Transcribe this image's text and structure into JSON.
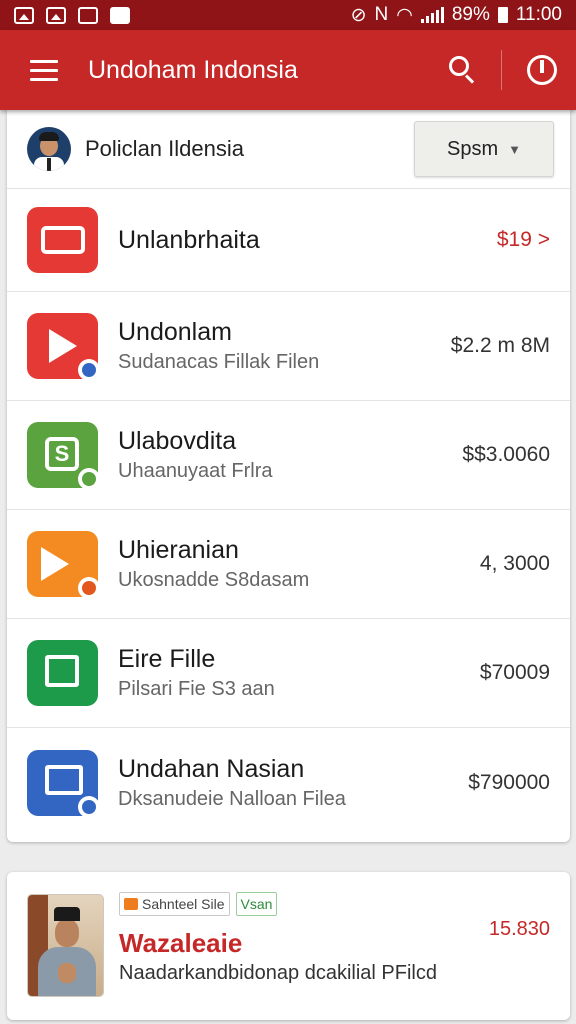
{
  "status_bar": {
    "battery": "89%",
    "time": "11:00"
  },
  "app_bar": {
    "title": "Undoham Indonsia"
  },
  "account": {
    "name": "Policlan Ildensia",
    "dropdown_label": "Spsm"
  },
  "apps": [
    {
      "title": "Unlanbrhaita",
      "subtitle": "",
      "value": "$19 >",
      "icon": "wallet-icon",
      "color": "#e53935"
    },
    {
      "title": "Undonlam",
      "subtitle": "Sudanacas Fillak Filen",
      "value": "$2.2 m 8M",
      "icon": "play-icon",
      "color": "#e53935"
    },
    {
      "title": "Ulabovdita",
      "subtitle": "Uhaanuyaat Frlra",
      "value": "$$3.0060",
      "icon": "sheet-icon",
      "color": "#5aa33e"
    },
    {
      "title": "Uhieranian",
      "subtitle": "Ukosnadde S8dasam",
      "value": "4, 3000",
      "icon": "media-icon",
      "color": "#f38b22"
    },
    {
      "title": "Eire Fille",
      "subtitle": "Pilsari Fie S3 aan",
      "value": "$70009",
      "icon": "files-icon",
      "color": "#1e9a4b"
    },
    {
      "title": "Undahan Nasian",
      "subtitle": "Dksanudeie Nalloan Filea",
      "value": "$790000",
      "icon": "document-icon",
      "color": "#3366c2"
    }
  ],
  "featured": {
    "tag1": "Sahnteel Sile",
    "tag2": "Vsan",
    "title": "Wazaleaie",
    "subtitle": "Naadarkandbidonap dcakilial PFilcd",
    "value": "15.830"
  }
}
